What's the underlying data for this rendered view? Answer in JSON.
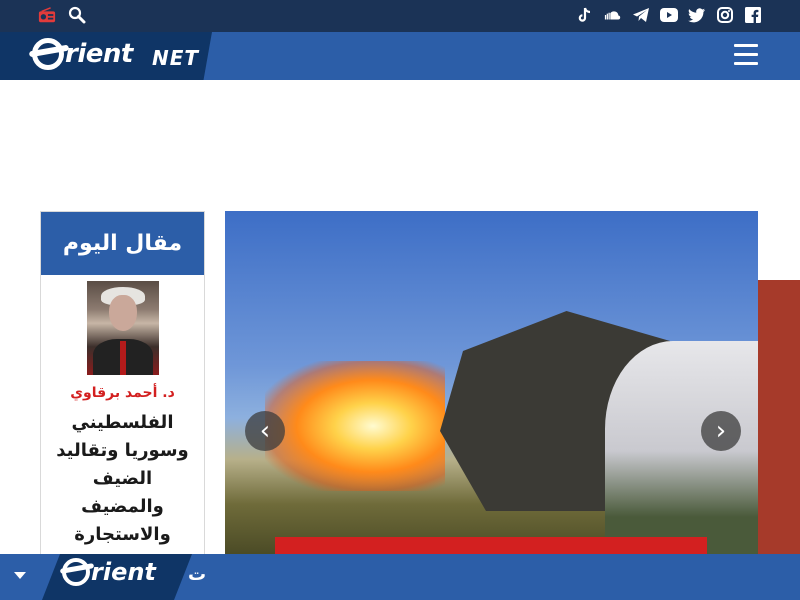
{
  "header": {
    "left_tools": [
      {
        "icon": "radio-icon"
      },
      {
        "icon": "search-icon"
      }
    ],
    "social": [
      {
        "icon": "tiktok-icon"
      },
      {
        "icon": "soundcloud-icon"
      },
      {
        "icon": "telegram-icon"
      },
      {
        "icon": "youtube-icon"
      },
      {
        "icon": "twitter-icon"
      },
      {
        "icon": "instagram-icon"
      },
      {
        "icon": "facebook-icon"
      }
    ]
  },
  "nav": {
    "logo_text": "rient",
    "logo_suffix": "NET",
    "menu_icon": "hamburger-icon"
  },
  "article_of_day": {
    "heading": "مقال اليوم",
    "author": "د. أحمد برقاوي",
    "title": "الفلسطيني وسوريا وتقاليد الضيف والمضيف والاستجارة"
  },
  "slider": {
    "prev_label": "‹",
    "next_label": "›"
  },
  "footer": {
    "logo_text": "rient",
    "ticker_text": "ت"
  },
  "colors": {
    "topbar": "#1b3356",
    "navbar": "#2c5ea8",
    "accent_red": "#d32020"
  }
}
